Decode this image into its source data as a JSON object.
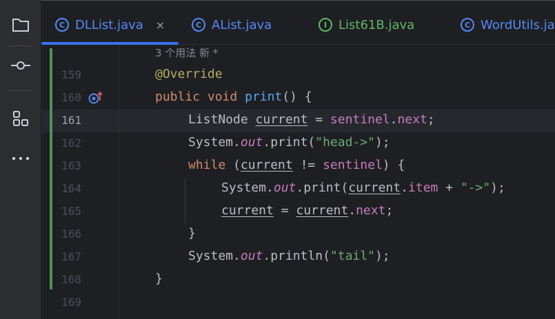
{
  "sidebar": {
    "icons": [
      "folder-icon",
      "commit-icon",
      "structure-icon",
      "more-icon"
    ]
  },
  "tabs": [
    {
      "label": "DLList.java",
      "kind": "class",
      "active": true,
      "close": "×"
    },
    {
      "label": "AList.java",
      "kind": "class",
      "active": false
    },
    {
      "label": "List61B.java",
      "kind": "interface",
      "active": false
    },
    {
      "label": "WordUtils.ja",
      "kind": "class",
      "active": false
    }
  ],
  "editor": {
    "usage_hint": "3 个用法   新 *",
    "line_numbers": [
      "159",
      "160",
      "161",
      "162",
      "163",
      "164",
      "165",
      "166",
      "167",
      "168",
      "169"
    ],
    "current_line": "161",
    "code": {
      "l159_annotation": "@Override",
      "l160_public": "public",
      "l160_void": "void",
      "l160_name": "print",
      "l160_rest": "() {",
      "l161_type": "ListNode ",
      "l161_var": "current",
      "l161_eq": " = ",
      "l161_sentinel": "sentinel",
      "l161_dot": ".",
      "l161_next": "next",
      "l161_semi": ";",
      "l162_system": "System.",
      "l162_out": "out",
      "l162_print": ".print(",
      "l162_str": "\"head->\"",
      "l162_end": ");",
      "l163_while": "while",
      "l163_open": " (",
      "l163_var": "current",
      "l163_ne": " != ",
      "l163_sentinel": "sentinel",
      "l163_close": ") {",
      "l164_system": "System.",
      "l164_out": "out",
      "l164_print": ".print(",
      "l164_var": "current",
      "l164_dot": ".",
      "l164_item": "item",
      "l164_plus": " + ",
      "l164_str": "\"->\"",
      "l164_end": ");",
      "l165_var": "current",
      "l165_eq": " = ",
      "l165_var2": "current",
      "l165_dot": ".",
      "l165_next": "next",
      "l165_semi": ";",
      "l166_brace": "}",
      "l167_system": "System.",
      "l167_out": "out",
      "l167_println": ".println(",
      "l167_str": "\"tail\"",
      "l167_end": ");",
      "l168_brace": "}"
    }
  },
  "colors": {
    "background": "#1e1f22",
    "keyword": "#cf8e6d",
    "annotation": "#b3ae60",
    "method": "#56a8f5",
    "field": "#c77dbb",
    "string": "#6aab73",
    "accent": "#3574f0",
    "vcs_added": "#549159"
  }
}
